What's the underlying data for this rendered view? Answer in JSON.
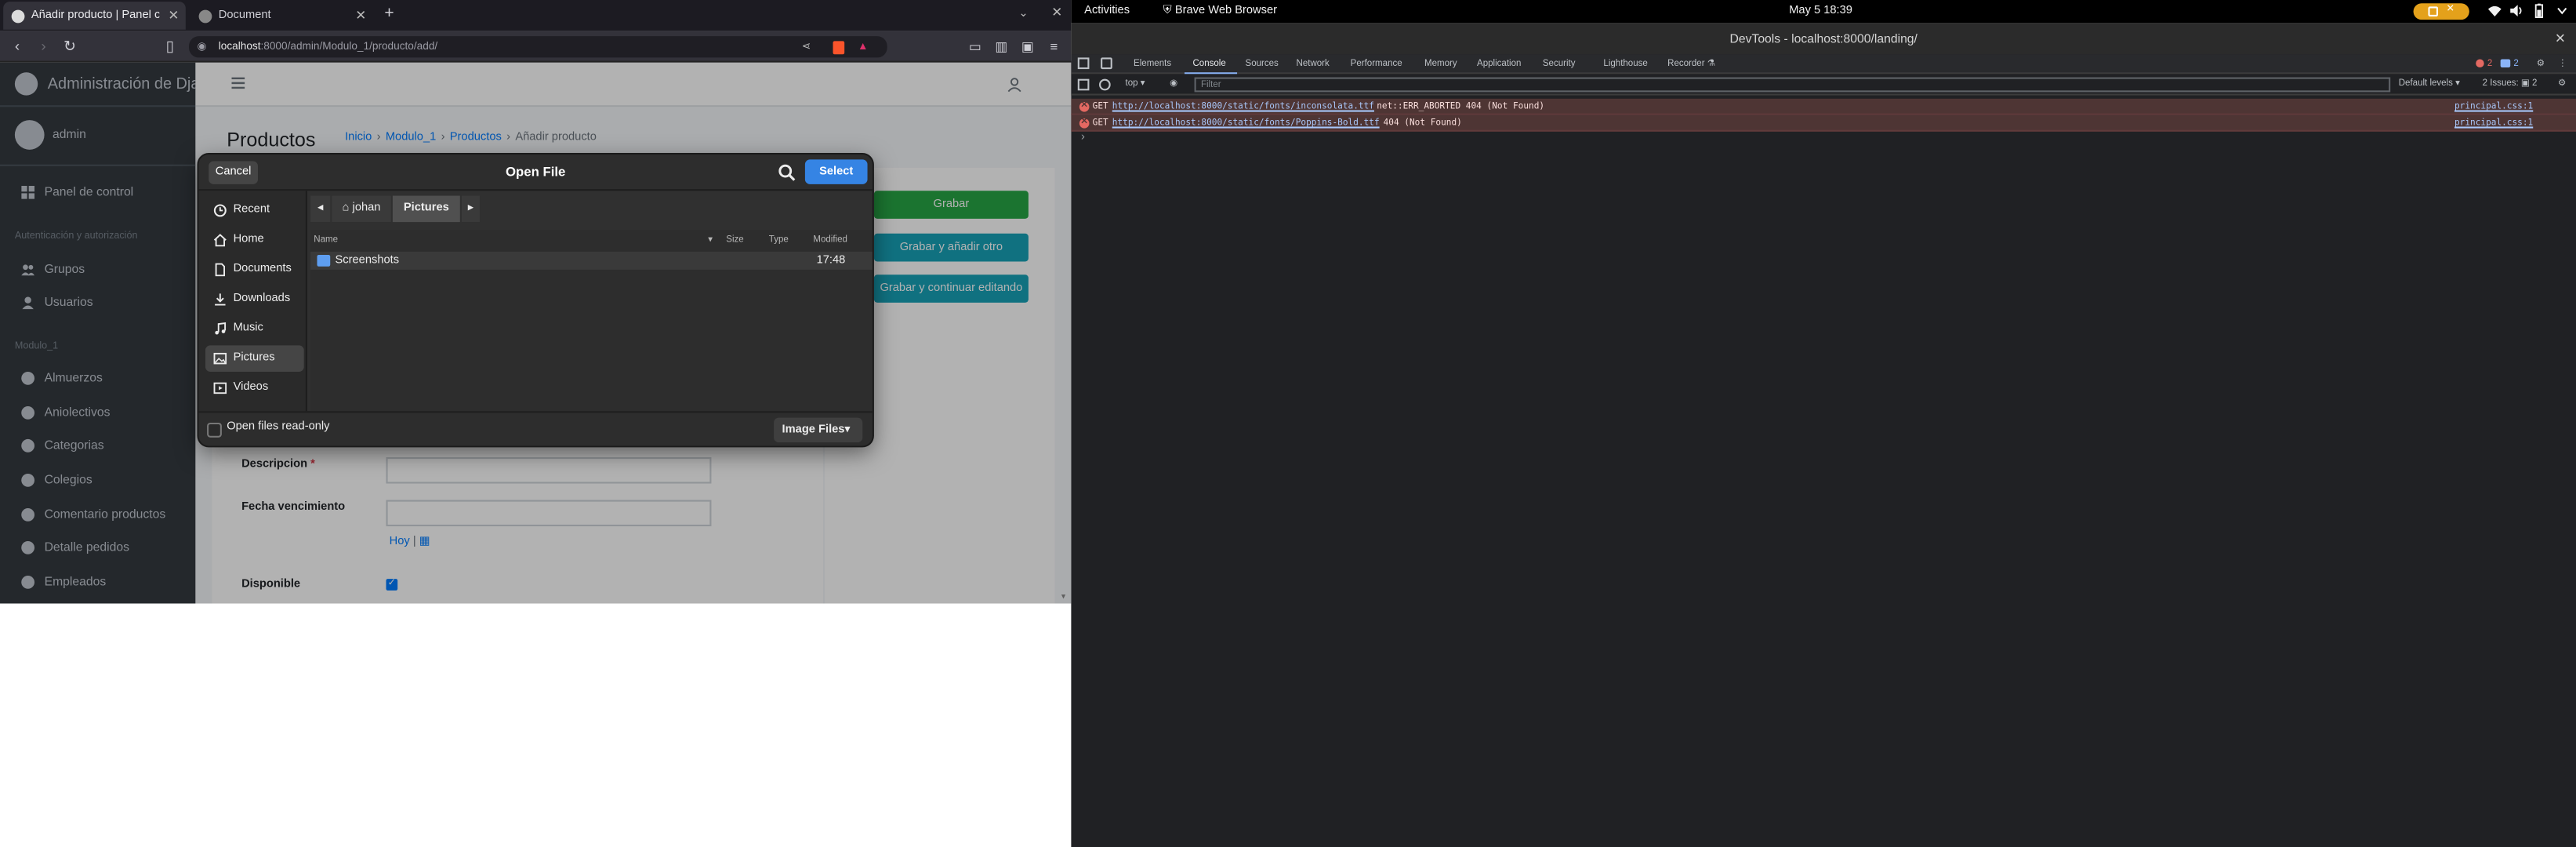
{
  "browser": {
    "tabs": [
      {
        "title": "Añadir producto | Panel c"
      },
      {
        "title": "Document"
      }
    ],
    "new_tab": "+",
    "url_host": "localhost",
    "url_path": ":8000/admin/Modulo_1/producto/add/"
  },
  "admin": {
    "brand": "Administración de Djan",
    "user": "admin",
    "sidebar": {
      "dashboard": "Panel de control",
      "section_auth": "Autenticación y autorización",
      "groups": "Grupos",
      "users": "Usuarios",
      "section_modulo": "Modulo_1",
      "models": [
        "Almuerzos",
        "Aniolectivos",
        "Categorias",
        "Colegios",
        "Comentario productos",
        "Detalle pedidos",
        "Empleados"
      ]
    },
    "page_title": "Productos",
    "breadcrumb": {
      "home": "Inicio",
      "module": "Modulo_1",
      "model": "Productos",
      "current": "Añadir producto",
      "sep": "›"
    },
    "buttons": {
      "save": "Grabar",
      "save_add": "Grabar y añadir otro",
      "save_continue": "Grabar y continuar editando"
    },
    "fields": {
      "descripcion": "Descripcion",
      "required_mark": "*",
      "fecha": "Fecha vencimiento",
      "hoy": "Hoy",
      "hoy_sep": "|",
      "disponible": "Disponible",
      "disponible_checked": true
    },
    "colors": {
      "sidebar": "#343a40",
      "primary": "#007bff",
      "success": "#28a745",
      "info": "#17a2b8"
    }
  },
  "dialog": {
    "title": "Open File",
    "cancel": "Cancel",
    "select": "Select",
    "places": [
      "Recent",
      "Home",
      "Documents",
      "Downloads",
      "Music",
      "Pictures",
      "Videos"
    ],
    "selected_place": "Pictures",
    "path": [
      "johan",
      "Pictures"
    ],
    "columns": {
      "name": "Name",
      "size": "Size",
      "type": "Type",
      "modified": "Modified"
    },
    "files": [
      {
        "name": "Screenshots",
        "modified": "17:48",
        "icon": "folder-icon"
      }
    ],
    "read_only_label": "Open files read-only",
    "filter": "Image Files",
    "accent": "#3584e4"
  },
  "topbar": {
    "activities": "Activities",
    "app": "Brave Web Browser",
    "clock": "May 5  18:39"
  },
  "devtools": {
    "title": "DevTools - localhost:8000/landing/",
    "tabs": [
      "Elements",
      "Console",
      "Sources",
      "Network",
      "Performance",
      "Memory",
      "Application",
      "Security",
      "Lighthouse",
      "Recorder ⚗"
    ],
    "active_tab": "Console",
    "context": "top ▾",
    "filter_placeholder": "Filter",
    "levels": "Default levels ▾",
    "issues": "2 Issues:  ▣ 2",
    "error_count": "2",
    "warn_count": "2",
    "errors": [
      {
        "method": "GET",
        "url": "http://localhost:8000/static/fonts/inconsolata.ttf",
        "msg": "net::ERR_ABORTED 404 (Not Found)",
        "source": "principal.css:1"
      },
      {
        "method": "GET",
        "url": "http://localhost:8000/static/fonts/Poppins-Bold.ttf",
        "msg": "404 (Not Found)",
        "source": "principal.css:1"
      }
    ],
    "prompt": "›"
  }
}
